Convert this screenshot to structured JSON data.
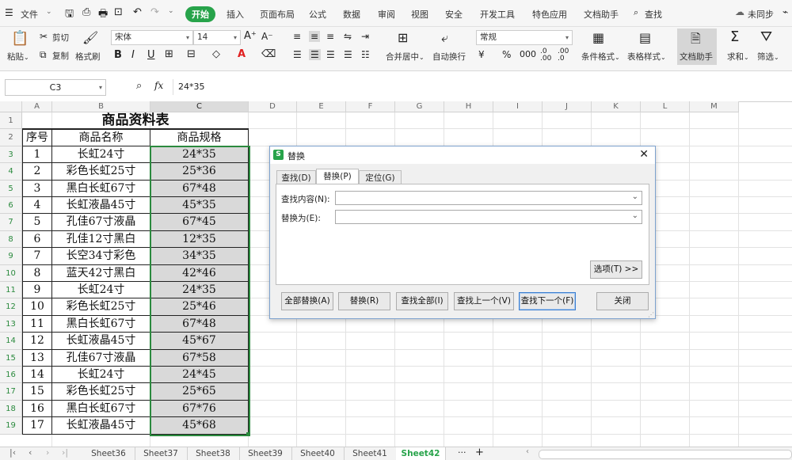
{
  "menubar": {
    "file": "文件",
    "tabs": [
      "开始",
      "插入",
      "页面布局",
      "公式",
      "数据",
      "审阅",
      "视图",
      "安全",
      "开发工具",
      "特色应用",
      "文档助手"
    ],
    "search": "查找",
    "sync": "未同步"
  },
  "ribbon": {
    "paste": "粘贴",
    "cut": "剪切",
    "copy": "复制",
    "format_painter": "格式刷",
    "font_name": "宋体",
    "font_size": "14",
    "number_format": "常规",
    "merge_center": "合并居中",
    "wrap_text": "自动换行",
    "cond_format": "条件格式",
    "table_style": "表格样式",
    "doc_helper": "文档助手",
    "sum": "求和",
    "filter": "筛选"
  },
  "formula": {
    "cell_ref": "C3",
    "fx": "fx",
    "value": "24*35"
  },
  "grid": {
    "columns": [
      "A",
      "B",
      "C",
      "D",
      "E",
      "F",
      "G",
      "H",
      "I",
      "J",
      "K",
      "L",
      "M"
    ],
    "rows": [
      "1",
      "2",
      "3",
      "4",
      "5",
      "6",
      "7",
      "8",
      "9",
      "10",
      "11",
      "12",
      "13",
      "14",
      "15",
      "16",
      "17",
      "18",
      "19"
    ],
    "title": "商品资料表",
    "headers": [
      "序号",
      "商品名称",
      "商品规格"
    ],
    "records": [
      [
        "1",
        "长虹24寸",
        "24*35"
      ],
      [
        "2",
        "彩色长虹25寸",
        "25*36"
      ],
      [
        "3",
        "黑白长虹67寸",
        "67*48"
      ],
      [
        "4",
        "长虹液晶45寸",
        "45*35"
      ],
      [
        "5",
        "孔佳67寸液晶",
        "67*45"
      ],
      [
        "6",
        "孔佳12寸黑白",
        "12*35"
      ],
      [
        "7",
        "长空34寸彩色",
        "34*35"
      ],
      [
        "8",
        "蓝天42寸黑白",
        "42*46"
      ],
      [
        "9",
        "长虹24寸",
        "24*35"
      ],
      [
        "10",
        "彩色长虹25寸",
        "25*46"
      ],
      [
        "11",
        "黑白长虹67寸",
        "67*48"
      ],
      [
        "12",
        "长虹液晶45寸",
        "45*67"
      ],
      [
        "13",
        "孔佳67寸液晶",
        "67*58"
      ],
      [
        "14",
        "长虹24寸",
        "24*45"
      ],
      [
        "15",
        "彩色长虹25寸",
        "25*65"
      ],
      [
        "16",
        "黑白长虹67寸",
        "67*76"
      ],
      [
        "17",
        "长虹液晶45寸",
        "45*68"
      ]
    ]
  },
  "dialog": {
    "title": "替换",
    "logo": "S",
    "tabs": [
      "查找(D)",
      "替换(P)",
      "定位(G)"
    ],
    "find_label": "查找内容(N):",
    "replace_label": "替换为(E):",
    "find_value": "",
    "replace_value": "",
    "options": "选项(T) >>",
    "buttons": [
      "全部替换(A)",
      "替换(R)",
      "查找全部(I)",
      "查找上一个(V)",
      "查找下一个(F)",
      "关闭"
    ]
  },
  "sheets": {
    "tabs": [
      "Sheet36",
      "Sheet37",
      "Sheet38",
      "Sheet39",
      "Sheet40",
      "Sheet41",
      "Sheet42"
    ],
    "active": "Sheet42",
    "more": "···",
    "add": "+"
  },
  "colors": {
    "accent": "#27a34a",
    "selection": "#2b8a3e",
    "cell_fill": "#d9d9d9"
  }
}
